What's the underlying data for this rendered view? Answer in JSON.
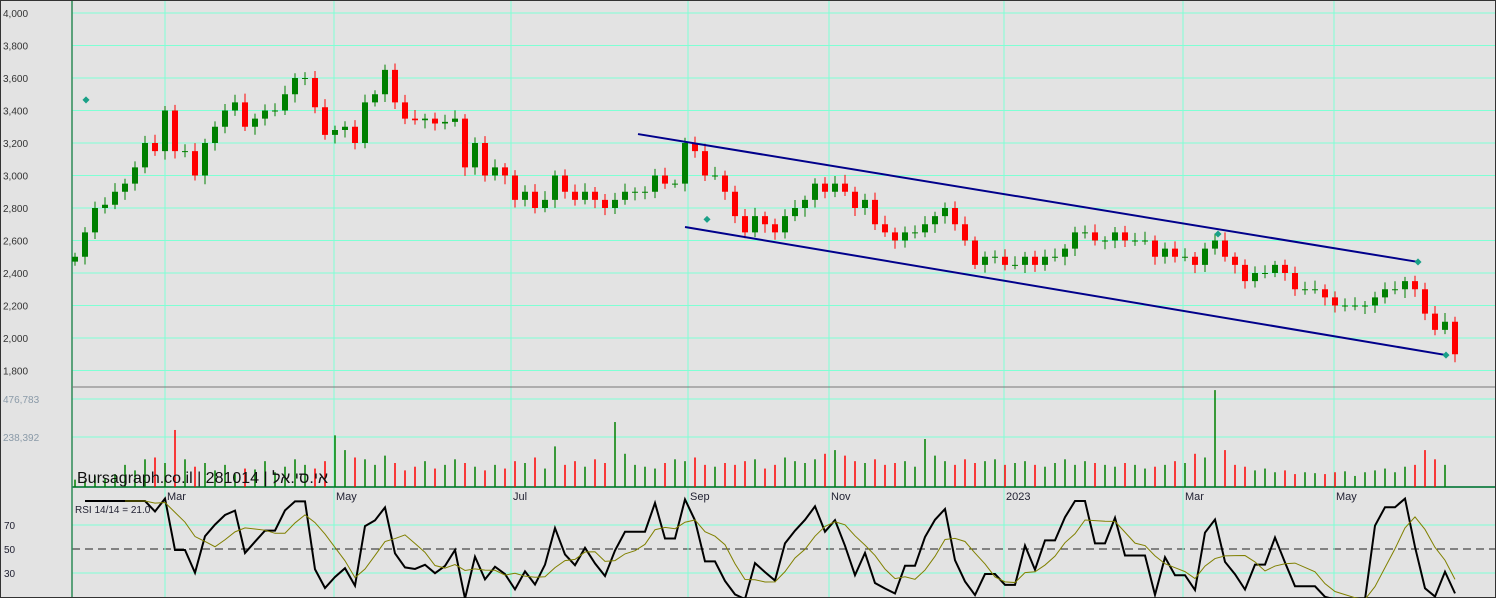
{
  "chart_data": {
    "type": "candlestick",
    "watermark": "Bursagraph.co.il | 281014 | אי.סי.אל",
    "price_axis": {
      "ticks": [
        "4,000",
        "3,800",
        "3,600",
        "3,400",
        "3,200",
        "3,000",
        "2,800",
        "2,600",
        "2,400",
        "2,200",
        "2,000",
        "1,800"
      ],
      "ylim": [
        1720,
        4060
      ]
    },
    "volume_axis": {
      "ticks": [
        "476,783",
        "238,392"
      ]
    },
    "x_ticks": [
      {
        "label": "Mar",
        "index": 9
      },
      {
        "label": "May",
        "index": 25.9
      },
      {
        "label": "Jul",
        "index": 43.6
      },
      {
        "label": "Sep",
        "index": 61.3
      },
      {
        "label": "Nov",
        "index": 75.4
      },
      {
        "label": "2023",
        "index": 92.9
      },
      {
        "label": "Mar",
        "index": 110.8
      },
      {
        "label": "May",
        "index": 125.9
      }
    ],
    "close": [
      2500,
      2650,
      2800,
      2820,
      2900,
      2950,
      3050,
      3200,
      3150,
      3400,
      3150,
      3150,
      3000,
      3200,
      3300,
      3400,
      3450,
      3300,
      3350,
      3400,
      3400,
      3500,
      3600,
      3600,
      3420,
      3250,
      3280,
      3300,
      3200,
      3450,
      3500,
      3650,
      3450,
      3350,
      3340,
      3350,
      3320,
      3330,
      3350,
      3050,
      3200,
      3000,
      3050,
      3000,
      2850,
      2900,
      2800,
      2850,
      3000,
      2900,
      2850,
      2900,
      2850,
      2800,
      2850,
      2900,
      2900,
      2900,
      3000,
      2950,
      2950,
      3200,
      3150,
      3000,
      3000,
      2900,
      2750,
      2650,
      2750,
      2700,
      2650,
      2750,
      2800,
      2850,
      2950,
      2900,
      2950,
      2900,
      2800,
      2850,
      2700,
      2650,
      2600,
      2650,
      2650,
      2700,
      2750,
      2800,
      2700,
      2600,
      2450,
      2500,
      2500,
      2450,
      2450,
      2500,
      2450,
      2500,
      2500,
      2550,
      2650,
      2650,
      2600,
      2600,
      2650,
      2600,
      2600,
      2600,
      2500,
      2550,
      2500,
      2500,
      2450,
      2550,
      2600,
      2500,
      2450,
      2350,
      2400,
      2400,
      2450,
      2400,
      2300,
      2300,
      2300,
      2250,
      2200,
      2200,
      2200,
      2200,
      2250,
      2300,
      2300,
      2350,
      2300,
      2150,
      2050,
      2100,
      1900
    ],
    "volume": [
      40000,
      35000,
      60000,
      45000,
      70000,
      120000,
      90000,
      150000,
      160000,
      130000,
      309000,
      150000,
      110000,
      130000,
      90000,
      120000,
      70000,
      100000,
      95000,
      140000,
      80000,
      110000,
      150000,
      120000,
      100000,
      140000,
      280000,
      200000,
      160000,
      150000,
      120000,
      170000,
      130000,
      90000,
      110000,
      140000,
      100000,
      120000,
      150000,
      130000,
      110000,
      90000,
      120000,
      100000,
      140000,
      130000,
      160000,
      100000,
      220000,
      120000,
      140000,
      110000,
      150000,
      130000,
      352000,
      180000,
      120000,
      110000,
      100000,
      130000,
      150000,
      140000,
      160000,
      120000,
      110000,
      130000,
      120000,
      140000,
      150000,
      100000,
      120000,
      160000,
      140000,
      130000,
      150000,
      180000,
      200000,
      170000,
      140000,
      130000,
      150000,
      120000,
      130000,
      140000,
      110000,
      260000,
      170000,
      140000,
      120000,
      150000,
      130000,
      140000,
      150000,
      120000,
      130000,
      140000,
      120000,
      110000,
      130000,
      150000,
      120000,
      140000,
      130000,
      120000,
      110000,
      130000,
      120000,
      100000,
      110000,
      120000,
      140000,
      130000,
      180000,
      160000,
      525000,
      200000,
      120000,
      110000,
      90000,
      100000,
      80000,
      90000,
      70000,
      80000,
      75000,
      70000,
      80000,
      85000,
      60000,
      80000,
      90000,
      100000,
      80000,
      110000,
      120000,
      200000,
      150000,
      120000
    ],
    "trendlines": [
      {
        "from": {
          "index": 56.3,
          "price": 3255
        },
        "to": {
          "index": 134.3,
          "price": 2468
        },
        "color": "#00008b"
      },
      {
        "from": {
          "index": 61.0,
          "price": 2683
        },
        "to": {
          "index": 137.1,
          "price": 1895
        },
        "color": "#00008b"
      }
    ],
    "markers": [
      {
        "index": 1.1,
        "price": 3465
      },
      {
        "index": 63.2,
        "price": 2730
      },
      {
        "index": 114.3,
        "price": 2640
      },
      {
        "index": 134.3,
        "price": 2468
      },
      {
        "index": 137.1,
        "price": 1895
      }
    ],
    "rsi": {
      "label": "RSI 14/14 = 21.0",
      "levels": [
        "70",
        "50",
        "30"
      ],
      "line_color": "#000000",
      "ma_color": "#808000",
      "ref_line_color": "#cc0000"
    },
    "colors": {
      "up": "#008000",
      "down": "#ff0000",
      "grid": "#7fffd4",
      "background": "#e3e3e3"
    }
  }
}
